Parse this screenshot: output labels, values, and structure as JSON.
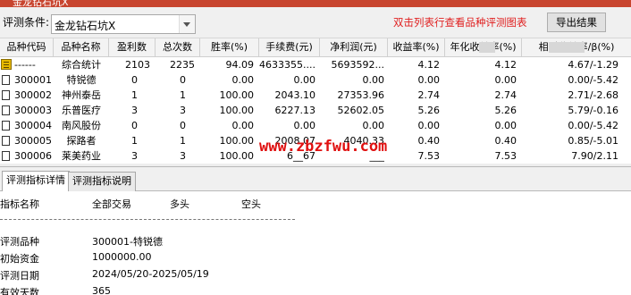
{
  "window": {
    "title": "金龙钻石坑X"
  },
  "toolbar": {
    "condition_label": "评测条件:",
    "condition_value": "金龙钻石坑X",
    "hint": "双击列表行查看品种评测图表",
    "export_label": "导出结果"
  },
  "columns": [
    "品种代码",
    "品种名称",
    "盈利数",
    "总次数",
    "胜率(%)",
    "手续费(元)",
    "净利润(元)",
    "收益率(%)",
    "年化收益率(%)",
    "相对收益率/β(%)"
  ],
  "rows": [
    {
      "code": "------",
      "name": "综合统计",
      "win": "2103",
      "total": "2235",
      "rate": "94.09",
      "fee": "4633355....",
      "profit": "5693592...",
      "ret": "4.12",
      "annual": "4.12",
      "rel": "4.67/-1.29",
      "icon": "summary-icon"
    },
    {
      "code": "300001",
      "name": "特锐德",
      "win": "0",
      "total": "0",
      "rate": "0.00",
      "fee": "0.00",
      "profit": "0.00",
      "ret": "0.00",
      "annual": "0.00",
      "rel": "0.00/-5.42",
      "icon": "document-icon"
    },
    {
      "code": "300002",
      "name": "神州泰岳",
      "win": "1",
      "total": "1",
      "rate": "100.00",
      "fee": "2043.10",
      "profit": "27353.96",
      "ret": "2.74",
      "annual": "2.74",
      "rel": "2.71/-2.68",
      "icon": "document-icon"
    },
    {
      "code": "300003",
      "name": "乐普医疗",
      "win": "3",
      "total": "3",
      "rate": "100.00",
      "fee": "6227.13",
      "profit": "52602.05",
      "ret": "5.26",
      "annual": "5.26",
      "rel": "5.79/-0.16",
      "icon": "document-icon"
    },
    {
      "code": "300004",
      "name": "南风股份",
      "win": "0",
      "total": "0",
      "rate": "0.00",
      "fee": "0.00",
      "profit": "0.00",
      "ret": "0.00",
      "annual": "0.00",
      "rel": "0.00/-5.42",
      "icon": "document-icon"
    },
    {
      "code": "300005",
      "name": "探路者",
      "win": "1",
      "total": "1",
      "rate": "100.00",
      "fee": "2008.07",
      "profit": "4040.33",
      "ret": "0.40",
      "annual": "0.40",
      "rel": "0.85/-5.01",
      "icon": "document-icon"
    },
    {
      "code": "300006",
      "name": "莱美药业",
      "win": "3",
      "total": "3",
      "rate": "100.00",
      "fee": "6__67",
      "profit": "___",
      "ret": "7.53",
      "annual": "7.53",
      "rel": "7.90/2.11",
      "icon": "document-icon"
    }
  ],
  "watermark": "www.zbzfwu.com",
  "tabs": [
    {
      "label": "评测指标详情",
      "active": true
    },
    {
      "label": "评测指标说明",
      "active": false
    }
  ],
  "detail": {
    "headers": [
      "指标名称",
      "全部交易",
      "多头",
      "空头"
    ],
    "lines": [
      {
        "label": "评测品种",
        "value": "300001-特锐德"
      },
      {
        "label": "初始资金",
        "value": "1000000.00"
      },
      {
        "label": "评测日期",
        "value": "2024/05/20-2025/05/19"
      },
      {
        "label": "有效天数",
        "value": "365"
      }
    ]
  }
}
